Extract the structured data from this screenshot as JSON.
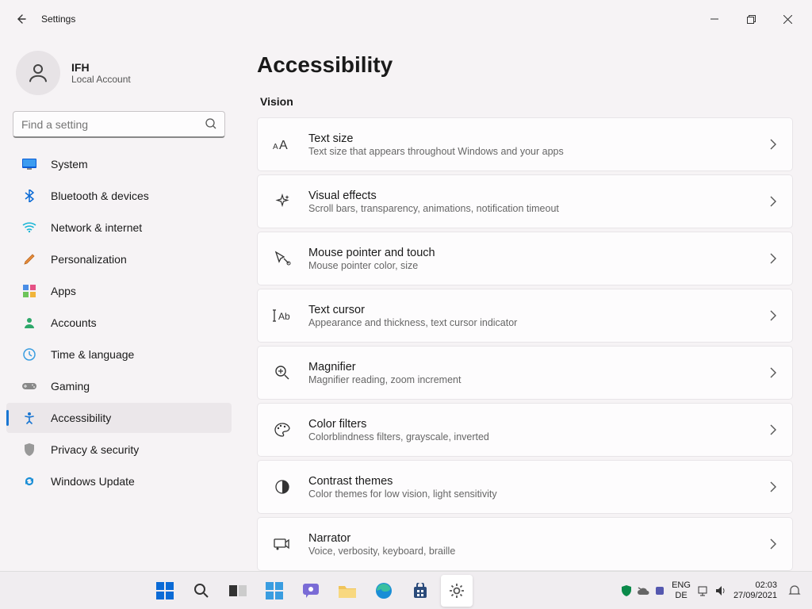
{
  "window": {
    "title": "Settings"
  },
  "user": {
    "name": "IFH",
    "subtitle": "Local Account"
  },
  "search": {
    "placeholder": "Find a setting"
  },
  "nav": {
    "items": [
      {
        "label": "System"
      },
      {
        "label": "Bluetooth & devices"
      },
      {
        "label": "Network & internet"
      },
      {
        "label": "Personalization"
      },
      {
        "label": "Apps"
      },
      {
        "label": "Accounts"
      },
      {
        "label": "Time & language"
      },
      {
        "label": "Gaming"
      },
      {
        "label": "Accessibility"
      },
      {
        "label": "Privacy & security"
      },
      {
        "label": "Windows Update"
      }
    ]
  },
  "page": {
    "title": "Accessibility",
    "section": "Vision",
    "cards": [
      {
        "title": "Text size",
        "sub": "Text size that appears throughout Windows and your apps"
      },
      {
        "title": "Visual effects",
        "sub": "Scroll bars, transparency, animations, notification timeout"
      },
      {
        "title": "Mouse pointer and touch",
        "sub": "Mouse pointer color, size"
      },
      {
        "title": "Text cursor",
        "sub": "Appearance and thickness, text cursor indicator"
      },
      {
        "title": "Magnifier",
        "sub": "Magnifier reading, zoom increment"
      },
      {
        "title": "Color filters",
        "sub": "Colorblindness filters, grayscale, inverted"
      },
      {
        "title": "Contrast themes",
        "sub": "Color themes for low vision, light sensitivity"
      },
      {
        "title": "Narrator",
        "sub": "Voice, verbosity, keyboard, braille"
      }
    ]
  },
  "taskbar": {
    "lang1": "ENG",
    "lang2": "DE",
    "time": "02:03",
    "date": "27/09/2021"
  }
}
